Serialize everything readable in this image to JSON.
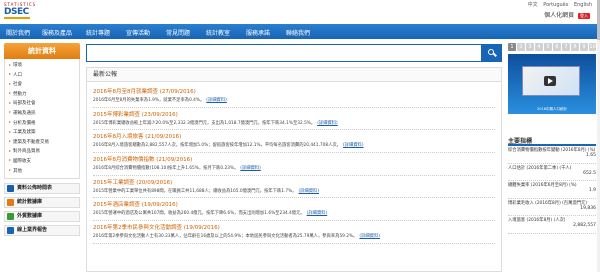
{
  "header": {
    "logo_top": "STATISTICS",
    "logo_main": "DSEC",
    "top_links": [
      "中文",
      "Português",
      "English"
    ],
    "user_greeting": "個人化網頁",
    "user_badge": "登入"
  },
  "nav": {
    "items": [
      "關於我們",
      "服務及產品",
      "統計專題",
      "宣傳活動",
      "常見問題",
      "統計教室",
      "服務承諾",
      "聯絡我們"
    ]
  },
  "sidebar": {
    "title": "統計資料",
    "items": [
      "環境",
      "人口",
      "社會",
      "勞動力",
      "局部及社會",
      "運輸及通訊",
      "分析及價格",
      "工業及建築",
      "建築及不動產交易",
      "對外商品貿易",
      "國際收支",
      "其他"
    ],
    "links": [
      "資料公佈時間表",
      "統計數據庫",
      "外貿數據庫",
      "線上業界報告"
    ]
  },
  "search": {
    "placeholder": ""
  },
  "news": {
    "heading": "最新公報",
    "more_label": "(詳細資料)",
    "items": [
      {
        "title": "2016年8月至8月就業調查 (27/09/2016)",
        "body": "2016年6月至8月的失業率為1.9%，就業不足率為0.4%。"
      },
      {
        "title": "2015年博彩業調查 (23/09/2016)",
        "body": "2015年博彩業總收益較上年減少20.0%至2,332.3億澳門元，支出為1,018.7億澳門元，按年下跌34.1%至32.5%。"
      },
      {
        "title": "2016年8月入境旅客 (21/09/2016)",
        "body": "2016年8月入境旅客總數為2,882,557人次，按年增加5.0%；留宿旅客按年增加12.1%，平均每名旅客消費的20,441,708人次。"
      },
      {
        "title": "2016年8月消費物價指數 (21/09/2016)",
        "body": "2016年8月綜合消費物價指數(108.10)按年上升1.65%，按月下跌0.23%。"
      },
      {
        "title": "2015年工業調查 (20/09/2016)",
        "body": "2015年營業中的工業單位共有898間，在職員工共11,688人；總收益為105.0億澳門元，按年下跌1.7%。"
      },
      {
        "title": "2015年酒店業調查 (19/09/2016)",
        "body": "2015年營運中的酒店及公寓共107間，收益為260.4億元，按年下降6.6%，而支出則增加1.6%至234.4億元。"
      },
      {
        "title": "2016年第2季市民參與文化活動調查 (19/09/2016)",
        "body": "2016年第2季參與文化活動人士有30.23萬人，佔年齡在16歲及以上的54.9%；本地居民參與文化活動者為25.79萬人，參與率為59.2%。"
      }
    ]
  },
  "right": {
    "page_buttons": [
      "1",
      "2",
      "3",
      "4",
      "5",
      "6",
      "7",
      "8",
      "9",
      "10"
    ],
    "active_page": "1",
    "banner_caption": "2016中期人口統計",
    "indicators_title": "主要指標",
    "indicators": [
      {
        "name": "綜合消費物價指數按年變動 (2016年8月) (%)",
        "value": "1.65"
      },
      {
        "name": "人口估計 (2016年第二季) (千人)",
        "value": "652.5"
      },
      {
        "name": "總體失業率 (2016年6月至8月) (%)",
        "value": "1.9"
      },
      {
        "name": "博彩業毛收入 (2016年8月) (百萬澳門元)",
        "value": "19,836"
      },
      {
        "name": "入境旅客 (2016年8月) (人次)",
        "value": "2,882,557"
      }
    ]
  }
}
